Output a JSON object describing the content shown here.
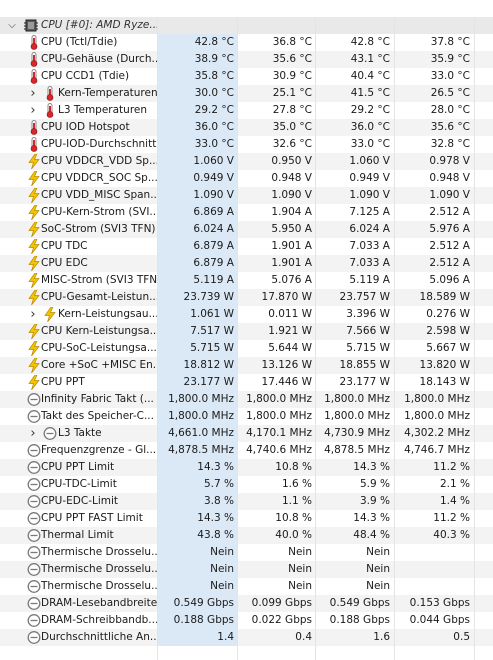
{
  "group": {
    "label": "CPU [#0]: AMD Ryze...",
    "icon": "cpu-chip-icon"
  },
  "rows": [
    {
      "icon": "thermometer-icon",
      "label": "CPU (Tctl/Tdie)",
      "cur": "42.8 °C",
      "min": "36.8 °C",
      "max": "42.8 °C",
      "avg": "37.8 °C"
    },
    {
      "icon": "thermometer-icon",
      "label": "CPU-Gehäuse (Durch...",
      "cur": "38.9 °C",
      "min": "35.6 °C",
      "max": "43.1 °C",
      "avg": "35.9 °C"
    },
    {
      "icon": "thermometer-icon",
      "label": "CPU CCD1 (Tdie)",
      "cur": "35.8 °C",
      "min": "30.9 °C",
      "max": "40.4 °C",
      "avg": "33.0 °C"
    },
    {
      "icon": "thermometer-icon",
      "label": "Kern-Temperaturen",
      "cur": "30.0 °C",
      "min": "25.1 °C",
      "max": "41.5 °C",
      "avg": "26.5 °C",
      "expandable": true
    },
    {
      "icon": "thermometer-icon",
      "label": "L3 Temperaturen",
      "cur": "29.2 °C",
      "min": "27.8 °C",
      "max": "29.2 °C",
      "avg": "28.0 °C",
      "expandable": true
    },
    {
      "icon": "thermometer-icon",
      "label": "CPU IOD Hotspot",
      "cur": "36.0 °C",
      "min": "35.0 °C",
      "max": "36.0 °C",
      "avg": "35.6 °C"
    },
    {
      "icon": "thermometer-icon",
      "label": "CPU-IOD-Durchschnitt",
      "cur": "33.0 °C",
      "min": "32.6 °C",
      "max": "33.0 °C",
      "avg": "32.8 °C"
    },
    {
      "icon": "lightning-icon",
      "label": "CPU VDDCR_VDD Sp...",
      "cur": "1.060 V",
      "min": "0.950 V",
      "max": "1.060 V",
      "avg": "0.978 V"
    },
    {
      "icon": "lightning-icon",
      "label": "CPU VDDCR_SOC Sp...",
      "cur": "0.949 V",
      "min": "0.948 V",
      "max": "0.949 V",
      "avg": "0.948 V"
    },
    {
      "icon": "lightning-icon",
      "label": "CPU VDD_MISC Span...",
      "cur": "1.090 V",
      "min": "1.090 V",
      "max": "1.090 V",
      "avg": "1.090 V"
    },
    {
      "icon": "lightning-icon",
      "label": "CPU-Kern-Strom (SVI...",
      "cur": "6.869 A",
      "min": "1.904 A",
      "max": "7.125 A",
      "avg": "2.512 A"
    },
    {
      "icon": "lightning-icon",
      "label": "SoC-Strom (SVI3 TFN)",
      "cur": "6.024 A",
      "min": "5.950 A",
      "max": "6.024 A",
      "avg": "5.976 A"
    },
    {
      "icon": "lightning-icon",
      "label": "CPU TDC",
      "cur": "6.879 A",
      "min": "1.901 A",
      "max": "7.033 A",
      "avg": "2.512 A"
    },
    {
      "icon": "lightning-icon",
      "label": "CPU EDC",
      "cur": "6.879 A",
      "min": "1.901 A",
      "max": "7.033 A",
      "avg": "2.512 A"
    },
    {
      "icon": "lightning-icon",
      "label": "MISC-Strom (SVI3 TFN)",
      "cur": "5.119 A",
      "min": "5.076 A",
      "max": "5.119 A",
      "avg": "5.096 A"
    },
    {
      "icon": "lightning-icon",
      "label": "CPU-Gesamt-Leistun...",
      "cur": "23.739 W",
      "min": "17.870 W",
      "max": "23.757 W",
      "avg": "18.589 W"
    },
    {
      "icon": "lightning-icon",
      "label": "Kern-Leistungsau...",
      "cur": "1.061 W",
      "min": "0.011 W",
      "max": "3.396 W",
      "avg": "0.276 W",
      "expandable": true
    },
    {
      "icon": "lightning-icon",
      "label": "CPU Kern-Leistungsa...",
      "cur": "7.517 W",
      "min": "1.921 W",
      "max": "7.566 W",
      "avg": "2.598 W"
    },
    {
      "icon": "lightning-icon",
      "label": "CPU-SoC-Leistungsa...",
      "cur": "5.715 W",
      "min": "5.644 W",
      "max": "5.715 W",
      "avg": "5.667 W"
    },
    {
      "icon": "lightning-icon",
      "label": "Core +SoC +MISC En...",
      "cur": "18.812 W",
      "min": "13.126 W",
      "max": "18.855 W",
      "avg": "13.820 W"
    },
    {
      "icon": "lightning-icon",
      "label": "CPU PPT",
      "cur": "23.177 W",
      "min": "17.446 W",
      "max": "23.177 W",
      "avg": "18.143 W"
    },
    {
      "icon": "clock-icon",
      "label": "Infinity Fabric Takt (...",
      "cur": "1,800.0 MHz",
      "min": "1,800.0 MHz",
      "max": "1,800.0 MHz",
      "avg": "1,800.0 MHz"
    },
    {
      "icon": "clock-icon",
      "label": "Takt des Speicher-C...",
      "cur": "1,800.0 MHz",
      "min": "1,800.0 MHz",
      "max": "1,800.0 MHz",
      "avg": "1,800.0 MHz"
    },
    {
      "icon": "clock-icon",
      "label": "L3 Takte",
      "cur": "4,661.0 MHz",
      "min": "4,170.1 MHz",
      "max": "4,730.9 MHz",
      "avg": "4,302.2 MHz",
      "expandable": true
    },
    {
      "icon": "clock-icon",
      "label": "Frequenzgrenze - Gl...",
      "cur": "4,878.5 MHz",
      "min": "4,740.6 MHz",
      "max": "4,878.5 MHz",
      "avg": "4,746.7 MHz"
    },
    {
      "icon": "clock-icon",
      "label": "CPU PPT Limit",
      "cur": "14.3 %",
      "min": "10.8 %",
      "max": "14.3 %",
      "avg": "11.2 %"
    },
    {
      "icon": "clock-icon",
      "label": "CPU-TDC-Limit",
      "cur": "5.7 %",
      "min": "1.6 %",
      "max": "5.9 %",
      "avg": "2.1 %"
    },
    {
      "icon": "clock-icon",
      "label": "CPU-EDC-Limit",
      "cur": "3.8 %",
      "min": "1.1 %",
      "max": "3.9 %",
      "avg": "1.4 %"
    },
    {
      "icon": "clock-icon",
      "label": "CPU PPT FAST Limit",
      "cur": "14.3 %",
      "min": "10.8 %",
      "max": "14.3 %",
      "avg": "11.2 %"
    },
    {
      "icon": "clock-icon",
      "label": "Thermal Limit",
      "cur": "43.8 %",
      "min": "40.0 %",
      "max": "48.4 %",
      "avg": "40.3 %"
    },
    {
      "icon": "clock-icon",
      "label": "Thermische Drosselu...",
      "cur": "Nein",
      "min": "Nein",
      "max": "Nein",
      "avg": ""
    },
    {
      "icon": "clock-icon",
      "label": "Thermische Drosselu...",
      "cur": "Nein",
      "min": "Nein",
      "max": "Nein",
      "avg": ""
    },
    {
      "icon": "clock-icon",
      "label": "Thermische Drosselu...",
      "cur": "Nein",
      "min": "Nein",
      "max": "Nein",
      "avg": ""
    },
    {
      "icon": "clock-icon",
      "label": "DRAM-Lesebandbreite",
      "cur": "0.549 Gbps",
      "min": "0.099 Gbps",
      "max": "0.549 Gbps",
      "avg": "0.153 Gbps"
    },
    {
      "icon": "clock-icon",
      "label": "DRAM-Schreibbandb...",
      "cur": "0.188 Gbps",
      "min": "0.022 Gbps",
      "max": "0.188 Gbps",
      "avg": "0.044 Gbps"
    },
    {
      "icon": "clock-icon",
      "label": "Durchschnittliche An...",
      "cur": "1.4",
      "min": "0.4",
      "max": "1.6",
      "avg": "0.5"
    }
  ],
  "colors": {
    "highlight": "#dbe9f7",
    "thermometer_red": "#d9262b",
    "lightning_yellow": "#f5c400",
    "lightning_outline": "#b88a00",
    "clock_gray": "#7a7a7a"
  }
}
